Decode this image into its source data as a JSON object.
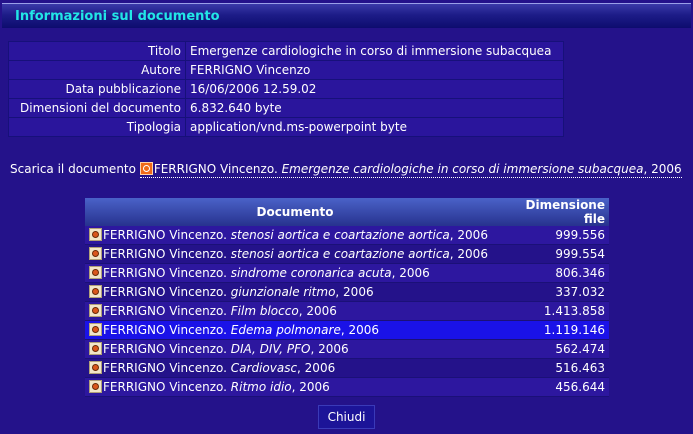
{
  "header": {
    "title": "Informazioni sul documento"
  },
  "info": [
    {
      "label": "Titolo",
      "value": "Emergenze cardiologiche in corso di immersione subacquea"
    },
    {
      "label": "Autore",
      "value": "FERRIGNO Vincenzo"
    },
    {
      "label": "Data pubblicazione",
      "value": "16/06/2006 12.59.02"
    },
    {
      "label": "Dimensioni del documento",
      "value": "6.832.640 byte"
    },
    {
      "label": "Tipologia",
      "value": "application/vnd.ms-powerpoint byte"
    }
  ],
  "download": {
    "prefix": "Scarica il documento",
    "author": "FERRIGNO Vincenzo.",
    "title": "Emergenze cardiologiche in corso di immersione subacquea",
    "year": ", 2006"
  },
  "files": {
    "col_document": "Documento",
    "col_size": "Dimensione file",
    "rows": [
      {
        "author": "FERRIGNO Vincenzo.",
        "title": "stenosi aortica e coartazione aortica",
        "year": ", 2006",
        "size": "999.556"
      },
      {
        "author": "FERRIGNO Vincenzo.",
        "title": "stenosi aortica e coartazione aortica",
        "year": ", 2006",
        "size": "999.554"
      },
      {
        "author": "FERRIGNO Vincenzo.",
        "title": "sindrome coronarica acuta",
        "year": ", 2006",
        "size": "806.346"
      },
      {
        "author": "FERRIGNO Vincenzo.",
        "title": "giunzionale ritmo",
        "year": ", 2006",
        "size": "337.032"
      },
      {
        "author": "FERRIGNO Vincenzo.",
        "title": "Film blocco",
        "year": ", 2006",
        "size": "1.413.858"
      },
      {
        "author": "FERRIGNO Vincenzo.",
        "title": "Edema polmonare",
        "year": ", 2006",
        "size": "1.119.146"
      },
      {
        "author": "FERRIGNO Vincenzo.",
        "title": "DIA, DIV, PFO",
        "year": ", 2006",
        "size": "562.474"
      },
      {
        "author": "FERRIGNO Vincenzo.",
        "title": "Cardiovasc",
        "year": ", 2006",
        "size": "516.463"
      },
      {
        "author": "FERRIGNO Vincenzo.",
        "title": "Ritmo idio",
        "year": ", 2006",
        "size": "456.644"
      }
    ]
  },
  "close_button": "Chiudi",
  "colors": {
    "background": "#24128a",
    "title_text": "#22e6e6",
    "row_highlight": "#1a12e8"
  }
}
